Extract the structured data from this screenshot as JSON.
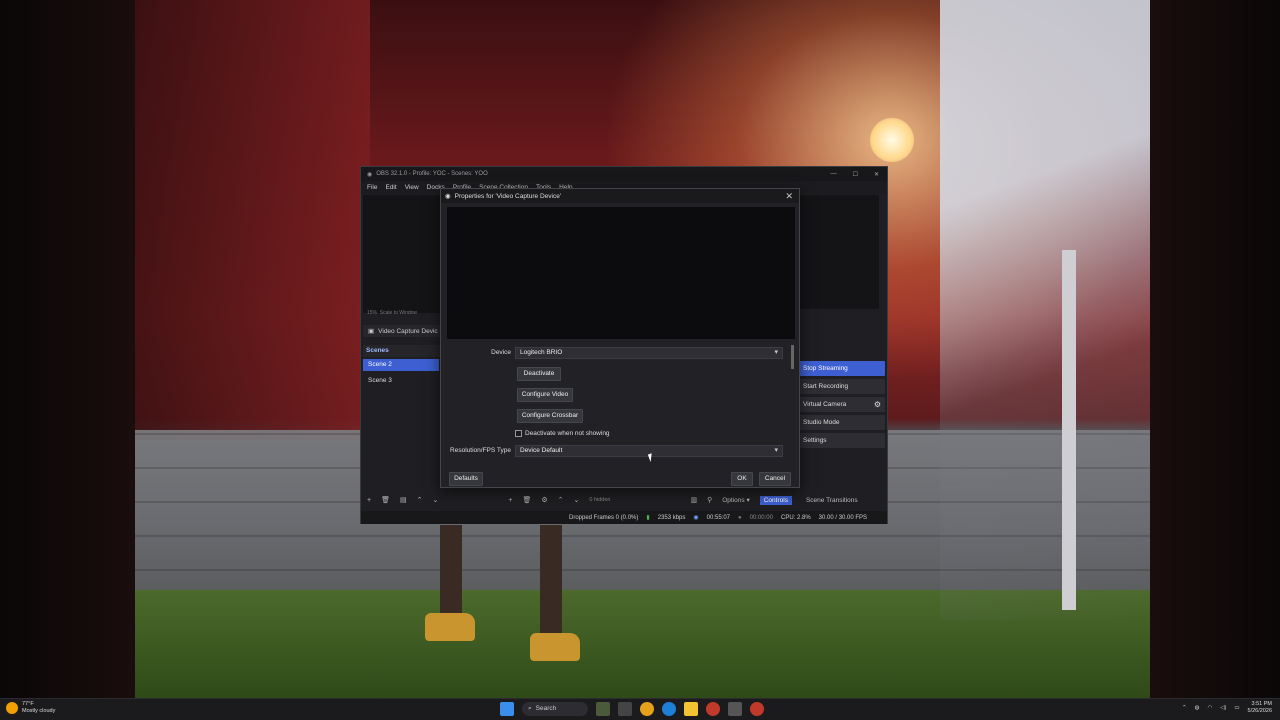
{
  "obs": {
    "window_title": "OBS 32.1.0 - Profile: YOC - Scenes: YOO",
    "menu": [
      "File",
      "Edit",
      "View",
      "Docks",
      "Profile",
      "Scene Collection",
      "Tools",
      "Help"
    ],
    "preview_controls": "Scale to Window",
    "preview_zoom": "15%",
    "source_bar_label": "Video Capture Devic",
    "scenes_header": "Scenes",
    "scenes": [
      "Scene 2",
      "Scene 3"
    ],
    "controls": {
      "stop_streaming": "Stop Streaming",
      "start_recording": "Start Recording",
      "virtual_camera": "Virtual Camera",
      "studio_mode": "Studio Mode",
      "settings": "Settings"
    },
    "toolbar": {
      "hidden_count": "0 hidden",
      "options_label": "Options",
      "controls_tab": "Controls",
      "scene_transitions_tab": "Scene Transitions"
    },
    "status": {
      "dropped_frames": "Dropped Frames 0 (0.0%)",
      "bitrate": "2353 kbps",
      "stream_time": "00:55:07",
      "rec_time": "00:00:00",
      "cpu": "CPU: 2.8%",
      "fps": "30.00 / 30.00 FPS"
    }
  },
  "dialog": {
    "title": "Properties for 'Video Capture Device'",
    "device_label": "Device",
    "device_value": "Logitech BRIO",
    "deactivate_button": "Deactivate",
    "configure_video_button": "Configure Video",
    "configure_crossbar_button": "Configure Crossbar",
    "deactivate_checkbox_label": "Deactivate when not showing",
    "resolution_label": "Resolution/FPS Type",
    "resolution_value": "Device Default",
    "defaults_button": "Defaults",
    "ok_button": "OK",
    "cancel_button": "Cancel"
  },
  "taskbar": {
    "weather_temp": "77°F",
    "weather_desc": "Mostly cloudy",
    "search_placeholder": "Search",
    "time": "3:51 PM",
    "date": "5/26/2026"
  },
  "colors": {
    "accent": "#3d5fd1",
    "dialog_bg": "#222226",
    "window_bg": "#1f1f23"
  }
}
